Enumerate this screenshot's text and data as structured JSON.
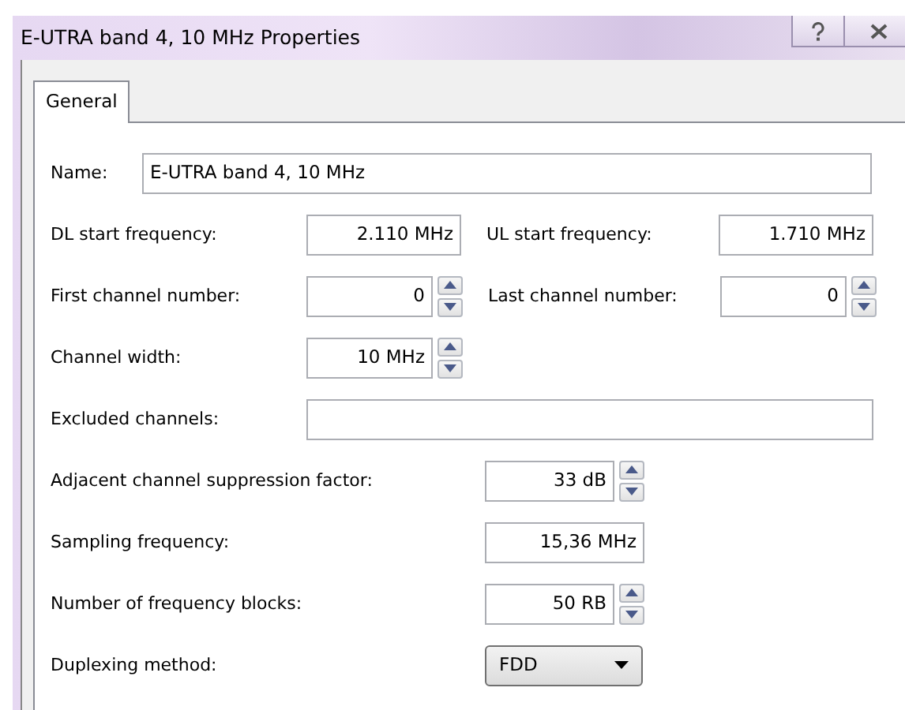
{
  "window": {
    "title": "E-UTRA band 4, 10 MHz Properties"
  },
  "tabs": [
    {
      "label": "General",
      "selected": true
    }
  ],
  "rows": [
    {
      "kind": "name",
      "fields": [
        {
          "label": "Name:",
          "kind": "entry",
          "value": "E-UTRA band 4, 10 MHz"
        }
      ]
    },
    {
      "kind": "pair",
      "fields": [
        {
          "label": "DL start frequency:",
          "kind": "text",
          "value": "2.110  MHz"
        },
        {
          "label": "UL start frequency:",
          "kind": "text",
          "value": "1.710  MHz"
        }
      ]
    },
    {
      "kind": "pair",
      "fields": [
        {
          "label": "First channel number:",
          "kind": "spin",
          "value": "0"
        },
        {
          "label": "Last channel number:",
          "kind": "spin",
          "value": "0"
        }
      ]
    },
    {
      "kind": "pair",
      "fields": [
        {
          "label": "Channel width:",
          "kind": "spin",
          "value": "10  MHz"
        }
      ]
    },
    {
      "kind": "wide",
      "fields": [
        {
          "label": "Excluded channels:",
          "kind": "entry"
        }
      ]
    },
    {
      "kind": "long",
      "fields": [
        {
          "label": "Adjacent channel suppression factor:",
          "kind": "spin",
          "value": "33  dB"
        }
      ]
    },
    {
      "kind": "long",
      "fields": [
        {
          "label": "Sampling frequency:",
          "kind": "text",
          "value": "15,36  MHz"
        }
      ]
    },
    {
      "kind": "long",
      "fields": [
        {
          "label": "Number of frequency blocks:",
          "kind": "spin",
          "value": "50  RB"
        }
      ]
    },
    {
      "kind": "long",
      "fields": [
        {
          "label": "Duplexing method:",
          "kind": "combo",
          "value": "FDD"
        }
      ]
    }
  ]
}
